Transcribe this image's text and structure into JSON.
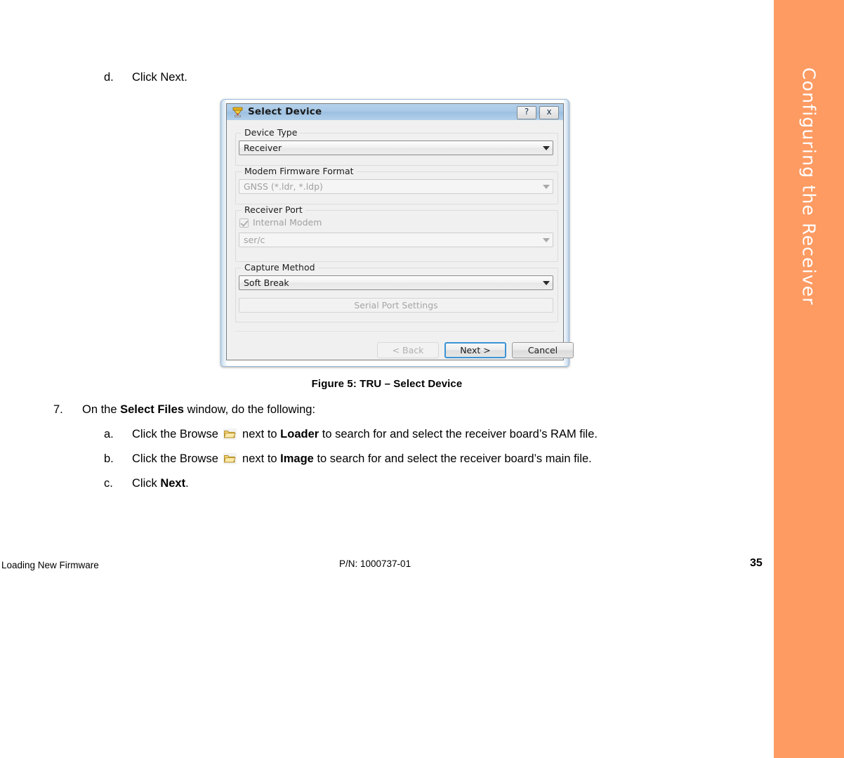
{
  "page": {
    "chapter_band_label": "Configuring the Receiver",
    "chapter_band_color": "#fd9b63"
  },
  "steps": {
    "d": {
      "marker": "d.",
      "text": "Click Next."
    },
    "seven": {
      "marker": "7.",
      "pre": "On the ",
      "bold": "Select Files",
      "post": " window, do the following:"
    },
    "a": {
      "marker": "a.",
      "pre": "Click the Browse ",
      "mid": " next to ",
      "bold": "Loader",
      "post": " to search for and select the receiver board’s RAM file."
    },
    "b": {
      "marker": "b.",
      "pre": "Click the Browse ",
      "mid": " next to ",
      "bold": "Image",
      "post": " to search for and select the receiver board’s main file."
    },
    "c": {
      "marker": "c.",
      "pre": "Click ",
      "bold": "Next",
      "post": "."
    }
  },
  "figure": {
    "caption": "Figure 5: TRU – Select Device"
  },
  "footer": {
    "left": "Loading New Firmware",
    "middle": "P/N: 1000737-01",
    "page_number": "35"
  },
  "dialog": {
    "title": "Select Device",
    "icon": "receiver-antenna-icon",
    "titlebar_buttons": {
      "help": "?",
      "close": "x"
    },
    "groups": {
      "device_type": {
        "label": "Device Type",
        "combo_value": "Receiver",
        "enabled": true
      },
      "modem_firmware_format": {
        "label": "Modem Firmware Format",
        "combo_value": "GNSS (*.ldr, *.ldp)",
        "enabled": false
      },
      "receiver_port": {
        "label": "Receiver Port",
        "checkbox_label": "Internal Modem",
        "checkbox_checked": true,
        "checkbox_enabled": false,
        "combo_value": "ser/c",
        "enabled": false
      },
      "capture_method": {
        "label": "Capture Method",
        "combo_value": "Soft Break",
        "enabled": true,
        "settings_button": "Serial Port Settings",
        "settings_enabled": false
      }
    },
    "buttons": {
      "back": {
        "label": "< Back",
        "accel": "B",
        "enabled": false
      },
      "next": {
        "label": "Next >",
        "default": true,
        "enabled": true
      },
      "cancel": {
        "label": "Cancel",
        "enabled": true
      }
    },
    "accent_focus_color": "#3c93d4"
  }
}
